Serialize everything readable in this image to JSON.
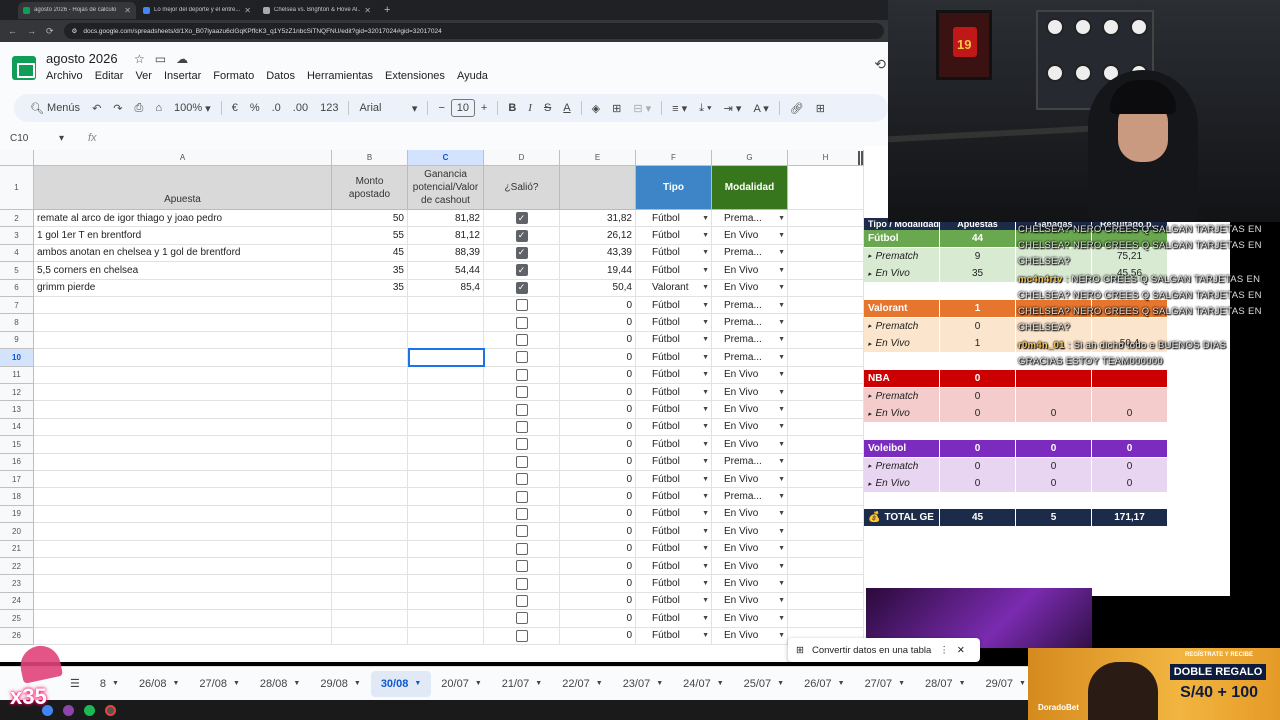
{
  "browser": {
    "tabs": [
      {
        "title": "agosto 2026 - Hojas de cálculo",
        "favicon_color": "#0f9d58"
      },
      {
        "title": "Lo mejor del deporte y el entre...",
        "favicon_color": "#4285f4"
      },
      {
        "title": "Chelsea vs. Brighton & Hove Al...",
        "favicon_color": "#aaaaaa"
      }
    ],
    "url": "docs.google.com/spreadsheets/d/1Xo_B07lyaazu6clGqKPffcK3_q1Y5zZ1nbcSiTNQFNU/edit?gid=32017024#gid=32017024"
  },
  "doc": {
    "title": "agosto 2026",
    "menus": [
      "Archivo",
      "Editar",
      "Ver",
      "Insertar",
      "Formato",
      "Datos",
      "Herramientas",
      "Extensiones",
      "Ayuda"
    ]
  },
  "toolbar": {
    "menus_label": "Menús",
    "zoom": "100%",
    "currency": "€",
    "percent": "%",
    "dec_less": ".0",
    "dec_more": ".00",
    "number_format": "123",
    "font": "Arial",
    "font_size": "10"
  },
  "formula": {
    "cell_ref": "C10",
    "fx": "fx"
  },
  "columns": [
    "A",
    "B",
    "C",
    "D",
    "E",
    "F",
    "G",
    "H"
  ],
  "header_row": {
    "apuesta": "Apuesta",
    "monto": "Monto apostado",
    "ganancia": "Ganancia potencial/Valor de cashout",
    "salio": "¿Salió?",
    "tipo": "Tipo",
    "modalidad": "Modalidad"
  },
  "rows": [
    {
      "n": "2",
      "a": "remate al arco de igor thiago y joao pedro",
      "b": "50",
      "c": "81,82",
      "d": true,
      "e": "31,82",
      "f": "Fútbol",
      "g": "Prema..."
    },
    {
      "n": "3",
      "a": "1 gol 1er T en brentford",
      "b": "55",
      "c": "81,12",
      "d": true,
      "e": "26,12",
      "f": "Fútbol",
      "g": "En Vivo"
    },
    {
      "n": "4",
      "a": "ambos anotan en chelsea y 1 gol de brentford",
      "b": "45",
      "c": "88,39",
      "d": true,
      "e": "43,39",
      "f": "Fútbol",
      "g": "Prema..."
    },
    {
      "n": "5",
      "a": "5,5 corners en chelsea",
      "b": "35",
      "c": "54,44",
      "d": true,
      "e": "19,44",
      "f": "Fútbol",
      "g": "En Vivo"
    },
    {
      "n": "6",
      "a": "grimm pierde",
      "b": "35",
      "c": "85,4",
      "d": true,
      "e": "50,4",
      "f": "Valorant",
      "g": "En Vivo"
    },
    {
      "n": "7",
      "a": "",
      "b": "",
      "c": "",
      "d": false,
      "e": "0",
      "f": "Fútbol",
      "g": "Prema..."
    },
    {
      "n": "8",
      "a": "",
      "b": "",
      "c": "",
      "d": false,
      "e": "0",
      "f": "Fútbol",
      "g": "Prema..."
    },
    {
      "n": "9",
      "a": "",
      "b": "",
      "c": "",
      "d": false,
      "e": "0",
      "f": "Fútbol",
      "g": "Prema..."
    },
    {
      "n": "10",
      "a": "",
      "b": "",
      "c": "",
      "d": false,
      "e": "0",
      "f": "Fútbol",
      "g": "Prema..."
    },
    {
      "n": "11",
      "a": "",
      "b": "",
      "c": "",
      "d": false,
      "e": "0",
      "f": "Fútbol",
      "g": "En Vivo"
    },
    {
      "n": "12",
      "a": "",
      "b": "",
      "c": "",
      "d": false,
      "e": "0",
      "f": "Fútbol",
      "g": "En Vivo"
    },
    {
      "n": "13",
      "a": "",
      "b": "",
      "c": "",
      "d": false,
      "e": "0",
      "f": "Fútbol",
      "g": "En Vivo"
    },
    {
      "n": "14",
      "a": "",
      "b": "",
      "c": "",
      "d": false,
      "e": "0",
      "f": "Fútbol",
      "g": "En Vivo"
    },
    {
      "n": "15",
      "a": "",
      "b": "",
      "c": "",
      "d": false,
      "e": "0",
      "f": "Fútbol",
      "g": "En Vivo"
    },
    {
      "n": "16",
      "a": "",
      "b": "",
      "c": "",
      "d": false,
      "e": "0",
      "f": "Fútbol",
      "g": "Prema..."
    },
    {
      "n": "17",
      "a": "",
      "b": "",
      "c": "",
      "d": false,
      "e": "0",
      "f": "Fútbol",
      "g": "En Vivo"
    },
    {
      "n": "18",
      "a": "",
      "b": "",
      "c": "",
      "d": false,
      "e": "0",
      "f": "Fútbol",
      "g": "Prema..."
    },
    {
      "n": "19",
      "a": "",
      "b": "",
      "c": "",
      "d": false,
      "e": "0",
      "f": "Fútbol",
      "g": "En Vivo"
    },
    {
      "n": "20",
      "a": "",
      "b": "",
      "c": "",
      "d": false,
      "e": "0",
      "f": "Fútbol",
      "g": "En Vivo"
    },
    {
      "n": "21",
      "a": "",
      "b": "",
      "c": "",
      "d": false,
      "e": "0",
      "f": "Fútbol",
      "g": "En Vivo"
    },
    {
      "n": "22",
      "a": "",
      "b": "",
      "c": "",
      "d": false,
      "e": "0",
      "f": "Fútbol",
      "g": "En Vivo"
    },
    {
      "n": "23",
      "a": "",
      "b": "",
      "c": "",
      "d": false,
      "e": "0",
      "f": "Fútbol",
      "g": "En Vivo"
    },
    {
      "n": "24",
      "a": "",
      "b": "",
      "c": "",
      "d": false,
      "e": "0",
      "f": "Fútbol",
      "g": "En Vivo"
    },
    {
      "n": "25",
      "a": "",
      "b": "",
      "c": "",
      "d": false,
      "e": "0",
      "f": "Fútbol",
      "g": "En Vivo"
    },
    {
      "n": "26",
      "a": "",
      "b": "",
      "c": "",
      "d": false,
      "e": "0",
      "f": "Fútbol",
      "g": "En Vivo"
    }
  ],
  "summary": {
    "header": [
      "Tipo / Modalidad",
      "Apuestas",
      "Ganadas",
      "Resultado p..."
    ],
    "groups": [
      {
        "label": "Fútbol",
        "apuestas": "44",
        "ganadas": "",
        "resultado": "",
        "color": "#6aa84f",
        "light": "#d9ead3",
        "subs": [
          {
            "label": "Prematch",
            "apuestas": "9",
            "ganadas": "",
            "resultado": "75,21"
          },
          {
            "label": "En Vivo",
            "apuestas": "35",
            "ganadas": "",
            "resultado": "45,56"
          }
        ]
      },
      {
        "label": "Valorant",
        "apuestas": "1",
        "ganadas": "",
        "resultado": "",
        "color": "#e6752d",
        "light": "#fce5cd",
        "subs": [
          {
            "label": "Prematch",
            "apuestas": "0",
            "ganadas": "",
            "resultado": ""
          },
          {
            "label": "En Vivo",
            "apuestas": "1",
            "ganadas": "",
            "resultado": "50,4"
          }
        ]
      },
      {
        "label": "NBA",
        "apuestas": "0",
        "ganadas": "",
        "resultado": "",
        "color": "#cc0000",
        "light": "#f4cccc",
        "subs": [
          {
            "label": "Prematch",
            "apuestas": "0",
            "ganadas": "",
            "resultado": ""
          },
          {
            "label": "En Vivo",
            "apuestas": "0",
            "ganadas": "0",
            "resultado": "0"
          }
        ]
      },
      {
        "label": "Voleibol",
        "apuestas": "0",
        "ganadas": "0",
        "resultado": "0",
        "color": "#7b2cbf",
        "light": "#e8d5f2",
        "subs": [
          {
            "label": "Prematch",
            "apuestas": "0",
            "ganadas": "0",
            "resultado": "0"
          },
          {
            "label": "En Vivo",
            "apuestas": "0",
            "ganadas": "0",
            "resultado": "0"
          }
        ]
      }
    ],
    "total": {
      "label": "TOTAL GE",
      "apuestas": "45",
      "ganadas": "5",
      "resultado": "171,17",
      "icon": "money-bag"
    }
  },
  "chat": {
    "lines": [
      {
        "user": "",
        "text": "CHELSEA? NERO CREES Q SALGAN TARJETAS EN CHELSEA? NERO CREES Q SALGAN TARJETAS EN CHELSEA?"
      },
      {
        "user": "mc4n4rtv",
        "text": "NERO CREES Q SALGAN TARJETAS EN CHELSEA? NERO CREES Q SALGAN TARJETAS EN CHELSEA? NERO CREES Q SALGAN TARJETAS EN CHELSEA?"
      },
      {
        "user": "r0m4n_01",
        "text": "Si ah dicho todo e BUENOS DIAS GRACIAS ESTOY TEAM000000"
      }
    ]
  },
  "toast": {
    "text": "Convertir datos en una tabla"
  },
  "sheet_tabs": [
    "8",
    "26/08",
    "27/08",
    "28/08",
    "29/08",
    "30/08",
    "20/07",
    "21/07",
    "22/07",
    "23/07",
    "24/07",
    "25/07",
    "26/07",
    "27/07",
    "28/07",
    "29/07"
  ],
  "active_sheet": "30/08",
  "webcam": {
    "jersey_number": "19"
  },
  "promo": {
    "brand": "DoradoBet",
    "tagline": "REGÍSTRATE Y RECIBE",
    "headline": "DOBLE REGALO",
    "amount": "S/40 + 100"
  },
  "sticker": {
    "text": "x35"
  }
}
